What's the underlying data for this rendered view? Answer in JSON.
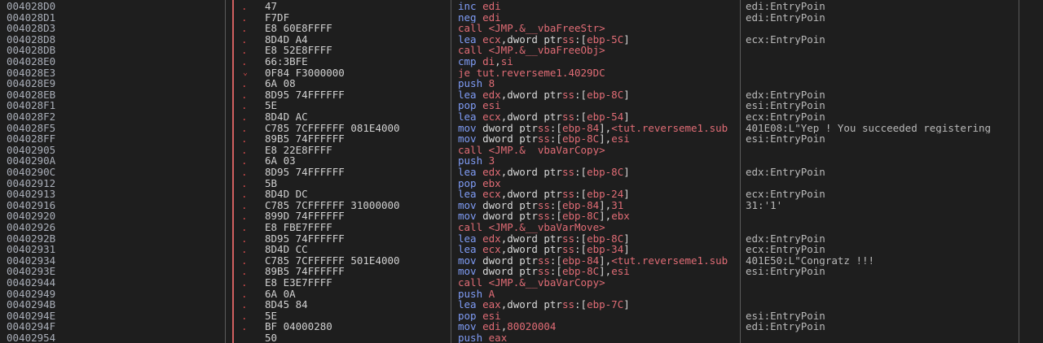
{
  "rows": [
    {
      "addr": "004028D0",
      "mark": ".",
      "bytes": "47",
      "instr": [
        {
          "t": "inc ",
          "k": "mn"
        },
        {
          "t": "edi",
          "k": "reg"
        }
      ],
      "comment": "edi:EntryPoin"
    },
    {
      "addr": "004028D1",
      "mark": ".",
      "bytes": "F7DF",
      "instr": [
        {
          "t": "neg ",
          "k": "mn"
        },
        {
          "t": "edi",
          "k": "reg"
        }
      ],
      "comment": "edi:EntryPoin"
    },
    {
      "addr": "004028D3",
      "mark": ".",
      "bytes": "E8 60E8FFFF",
      "instr": [
        {
          "t": "call <JMP.&__vbaFreeStr>",
          "k": "call"
        }
      ],
      "comment": ""
    },
    {
      "addr": "004028D8",
      "mark": ".",
      "bytes": "8D4D A4",
      "instr": [
        {
          "t": "lea ",
          "k": "mn"
        },
        {
          "t": "ecx",
          "k": "reg"
        },
        {
          "t": ",dword ptr",
          "k": "op"
        },
        {
          "t": "ss",
          "k": "reg"
        },
        {
          "t": ":[",
          "k": "op"
        },
        {
          "t": "ebp-5C",
          "k": "reg"
        },
        {
          "t": "]",
          "k": "op"
        }
      ],
      "comment": "ecx:EntryPoin"
    },
    {
      "addr": "004028DB",
      "mark": ".",
      "bytes": "E8 52E8FFFF",
      "instr": [
        {
          "t": "call <JMP.&__vbaFreeObj>",
          "k": "call"
        }
      ],
      "comment": ""
    },
    {
      "addr": "004028E0",
      "mark": ".",
      "bytes": "66:3BFE",
      "instr": [
        {
          "t": "cmp ",
          "k": "mn"
        },
        {
          "t": "di",
          "k": "reg"
        },
        {
          "t": ",",
          "k": "op"
        },
        {
          "t": "si",
          "k": "reg"
        }
      ],
      "comment": ""
    },
    {
      "addr": "004028E3",
      "mark": "⌄",
      "bytes": "0F84 F3000000",
      "instr": [
        {
          "t": "je tut.reverseme1.4029DC",
          "k": "jmp"
        }
      ],
      "comment": ""
    },
    {
      "addr": "004028E9",
      "mark": ".",
      "bytes": "6A 08",
      "instr": [
        {
          "t": "push ",
          "k": "mn"
        },
        {
          "t": "8",
          "k": "num"
        }
      ],
      "comment": ""
    },
    {
      "addr": "004028EB",
      "mark": ".",
      "bytes": "8D95 74FFFFFF",
      "instr": [
        {
          "t": "lea ",
          "k": "mn"
        },
        {
          "t": "edx",
          "k": "reg"
        },
        {
          "t": ",dword ptr",
          "k": "op"
        },
        {
          "t": "ss",
          "k": "reg"
        },
        {
          "t": ":[",
          "k": "op"
        },
        {
          "t": "ebp-8C",
          "k": "reg"
        },
        {
          "t": "]",
          "k": "op"
        }
      ],
      "comment": "edx:EntryPoin"
    },
    {
      "addr": "004028F1",
      "mark": ".",
      "bytes": "5E",
      "instr": [
        {
          "t": "pop ",
          "k": "mn"
        },
        {
          "t": "esi",
          "k": "reg"
        }
      ],
      "comment": "esi:EntryPoin"
    },
    {
      "addr": "004028F2",
      "mark": ".",
      "bytes": "8D4D AC",
      "instr": [
        {
          "t": "lea ",
          "k": "mn"
        },
        {
          "t": "ecx",
          "k": "reg"
        },
        {
          "t": ",dword ptr",
          "k": "op"
        },
        {
          "t": "ss",
          "k": "reg"
        },
        {
          "t": ":[",
          "k": "op"
        },
        {
          "t": "ebp-54",
          "k": "reg"
        },
        {
          "t": "]",
          "k": "op"
        }
      ],
      "comment": "ecx:EntryPoin"
    },
    {
      "addr": "004028F5",
      "mark": ".",
      "bytes": "C785 7CFFFFFF ",
      "bytes_u": "081E4000",
      "instr": [
        {
          "t": "mov ",
          "k": "mn"
        },
        {
          "t": "dword ptr",
          "k": "op"
        },
        {
          "t": "ss",
          "k": "reg"
        },
        {
          "t": ":[",
          "k": "op"
        },
        {
          "t": "ebp-84",
          "k": "reg"
        },
        {
          "t": "],",
          "k": "op"
        },
        {
          "t": "<tut.reverseme1.sub",
          "k": "call"
        }
      ],
      "comment": "401E08:L\"Yep ! You succeeded registering"
    },
    {
      "addr": "004028FF",
      "mark": ".",
      "bytes": "89B5 74FFFFFF",
      "instr": [
        {
          "t": "mov ",
          "k": "mn"
        },
        {
          "t": "dword ptr",
          "k": "op"
        },
        {
          "t": "ss",
          "k": "reg"
        },
        {
          "t": ":[",
          "k": "op"
        },
        {
          "t": "ebp-8C",
          "k": "reg"
        },
        {
          "t": "],",
          "k": "op"
        },
        {
          "t": "esi",
          "k": "reg"
        }
      ],
      "comment": "esi:EntryPoin"
    },
    {
      "addr": "00402905",
      "mark": ".",
      "bytes": "E8 22E8FFFF",
      "instr": [
        {
          "t": "call <JMP.&__vbaVarCopy>",
          "k": "call"
        }
      ],
      "comment": ""
    },
    {
      "addr": "0040290A",
      "mark": ".",
      "bytes": "6A 03",
      "instr": [
        {
          "t": "push ",
          "k": "mn"
        },
        {
          "t": "3",
          "k": "num"
        }
      ],
      "comment": ""
    },
    {
      "addr": "0040290C",
      "mark": ".",
      "bytes": "8D95 74FFFFFF",
      "instr": [
        {
          "t": "lea ",
          "k": "mn"
        },
        {
          "t": "edx",
          "k": "reg"
        },
        {
          "t": ",dword ptr",
          "k": "op"
        },
        {
          "t": "ss",
          "k": "reg"
        },
        {
          "t": ":[",
          "k": "op"
        },
        {
          "t": "ebp-8C",
          "k": "reg"
        },
        {
          "t": "]",
          "k": "op"
        }
      ],
      "comment": "edx:EntryPoin"
    },
    {
      "addr": "00402912",
      "mark": ".",
      "bytes": "5B",
      "instr": [
        {
          "t": "pop ",
          "k": "mn"
        },
        {
          "t": "ebx",
          "k": "reg"
        }
      ],
      "comment": ""
    },
    {
      "addr": "00402913",
      "mark": ".",
      "bytes": "8D4D DC",
      "instr": [
        {
          "t": "lea ",
          "k": "mn"
        },
        {
          "t": "ecx",
          "k": "reg"
        },
        {
          "t": ",dword ptr",
          "k": "op"
        },
        {
          "t": "ss",
          "k": "reg"
        },
        {
          "t": ":[",
          "k": "op"
        },
        {
          "t": "ebp-24",
          "k": "reg"
        },
        {
          "t": "]",
          "k": "op"
        }
      ],
      "comment": "ecx:EntryPoin"
    },
    {
      "addr": "00402916",
      "mark": ".",
      "bytes": "C785 7CFFFFFF 31000000",
      "instr": [
        {
          "t": "mov ",
          "k": "mn"
        },
        {
          "t": "dword ptr",
          "k": "op"
        },
        {
          "t": "ss",
          "k": "reg"
        },
        {
          "t": ":[",
          "k": "op"
        },
        {
          "t": "ebp-84",
          "k": "reg"
        },
        {
          "t": "],",
          "k": "op"
        },
        {
          "t": "31",
          "k": "num"
        }
      ],
      "comment": "31:'1'"
    },
    {
      "addr": "00402920",
      "mark": ".",
      "bytes": "899D 74FFFFFF",
      "instr": [
        {
          "t": "mov ",
          "k": "mn"
        },
        {
          "t": "dword ptr",
          "k": "op"
        },
        {
          "t": "ss",
          "k": "reg"
        },
        {
          "t": ":[",
          "k": "op"
        },
        {
          "t": "ebp-8C",
          "k": "reg"
        },
        {
          "t": "],",
          "k": "op"
        },
        {
          "t": "ebx",
          "k": "reg"
        }
      ],
      "comment": ""
    },
    {
      "addr": "00402926",
      "mark": ".",
      "bytes": "E8 FBE7FFFF",
      "instr": [
        {
          "t": "call <JMP.&__vbaVarMove>",
          "k": "call"
        }
      ],
      "comment": ""
    },
    {
      "addr": "0040292B",
      "mark": ".",
      "bytes": "8D95 74FFFFFF",
      "instr": [
        {
          "t": "lea ",
          "k": "mn"
        },
        {
          "t": "edx",
          "k": "reg"
        },
        {
          "t": ",dword ptr",
          "k": "op"
        },
        {
          "t": "ss",
          "k": "reg"
        },
        {
          "t": ":[",
          "k": "op"
        },
        {
          "t": "ebp-8C",
          "k": "reg"
        },
        {
          "t": "]",
          "k": "op"
        }
      ],
      "comment": "edx:EntryPoin"
    },
    {
      "addr": "00402931",
      "mark": ".",
      "bytes": "8D4D CC",
      "instr": [
        {
          "t": "lea ",
          "k": "mn"
        },
        {
          "t": "ecx",
          "k": "reg"
        },
        {
          "t": ",dword ptr",
          "k": "op"
        },
        {
          "t": "ss",
          "k": "reg"
        },
        {
          "t": ":[",
          "k": "op"
        },
        {
          "t": "ebp-34",
          "k": "reg"
        },
        {
          "t": "]",
          "k": "op"
        }
      ],
      "comment": "ecx:EntryPoin"
    },
    {
      "addr": "00402934",
      "mark": ".",
      "bytes": "C785 7CFFFFFF ",
      "bytes_u": "501E4000",
      "instr": [
        {
          "t": "mov ",
          "k": "mn"
        },
        {
          "t": "dword ptr",
          "k": "op"
        },
        {
          "t": "ss",
          "k": "reg"
        },
        {
          "t": ":[",
          "k": "op"
        },
        {
          "t": "ebp-84",
          "k": "reg"
        },
        {
          "t": "],",
          "k": "op"
        },
        {
          "t": "<tut.reverseme1.sub",
          "k": "call"
        }
      ],
      "comment": "401E50:L\"Congratz !!!"
    },
    {
      "addr": "0040293E",
      "mark": ".",
      "bytes": "89B5 74FFFFFF",
      "instr": [
        {
          "t": "mov ",
          "k": "mn"
        },
        {
          "t": "dword ptr",
          "k": "op"
        },
        {
          "t": "ss",
          "k": "reg"
        },
        {
          "t": ":[",
          "k": "op"
        },
        {
          "t": "ebp-8C",
          "k": "reg"
        },
        {
          "t": "],",
          "k": "op"
        },
        {
          "t": "esi",
          "k": "reg"
        }
      ],
      "comment": "esi:EntryPoin"
    },
    {
      "addr": "00402944",
      "mark": ".",
      "bytes": "E8 E3E7FFFF",
      "instr": [
        {
          "t": "call <JMP.&__vbaVarCopy>",
          "k": "call"
        }
      ],
      "comment": ""
    },
    {
      "addr": "00402949",
      "mark": ".",
      "bytes": "6A 0A",
      "instr": [
        {
          "t": "push ",
          "k": "mn"
        },
        {
          "t": "A",
          "k": "num"
        }
      ],
      "comment": ""
    },
    {
      "addr": "0040294B",
      "mark": ".",
      "bytes": "8D45 84",
      "instr": [
        {
          "t": "lea ",
          "k": "mn"
        },
        {
          "t": "eax",
          "k": "reg"
        },
        {
          "t": ",dword ptr",
          "k": "op"
        },
        {
          "t": "ss",
          "k": "reg"
        },
        {
          "t": ":[",
          "k": "op"
        },
        {
          "t": "ebp-7C",
          "k": "reg"
        },
        {
          "t": "]",
          "k": "op"
        }
      ],
      "comment": ""
    },
    {
      "addr": "0040294E",
      "mark": ".",
      "bytes": "5E",
      "instr": [
        {
          "t": "pop ",
          "k": "mn"
        },
        {
          "t": "esi",
          "k": "reg"
        }
      ],
      "comment": "esi:EntryPoin"
    },
    {
      "addr": "0040294F",
      "mark": ".",
      "bytes": "BF 04000280",
      "instr": [
        {
          "t": "mov ",
          "k": "mn"
        },
        {
          "t": "edi",
          "k": "reg"
        },
        {
          "t": ",",
          "k": "op"
        },
        {
          "t": "80020004",
          "k": "num"
        }
      ],
      "comment": "edi:EntryPoin"
    },
    {
      "addr": "00402954",
      "mark": "",
      "bytes": "50",
      "instr": [
        {
          "t": "push ",
          "k": "mn"
        },
        {
          "t": "eax",
          "k": "reg"
        }
      ],
      "comment": ""
    }
  ]
}
